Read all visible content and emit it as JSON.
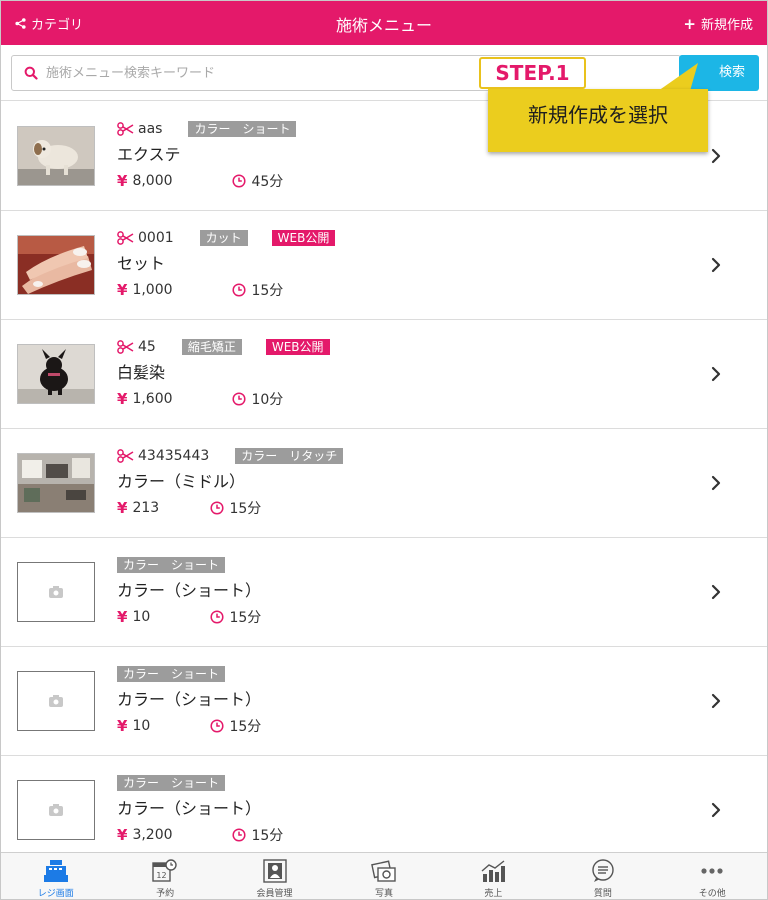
{
  "header": {
    "left_label": "カテゴリ",
    "title": "施術メニュー",
    "right_label": "新規作成",
    "color": "#e4196a"
  },
  "search": {
    "placeholder": "施術メニュー検索キーワード",
    "button_label": "検索",
    "button_color": "#1cb6e6"
  },
  "callout": {
    "step": "STEP.1",
    "text": "新規作成を選択",
    "color": "#ebcd1e"
  },
  "items": [
    {
      "code": "aas",
      "tags": [
        "カラー　ショート"
      ],
      "web": "",
      "name": "エクステ",
      "price": "8,000",
      "duration": "45分",
      "thumb": "dog"
    },
    {
      "code": "0001",
      "tags": [
        "カット"
      ],
      "web": "WEB公開",
      "name": "セット",
      "price": "1,000",
      "duration": "15分",
      "thumb": "nails"
    },
    {
      "code": "45",
      "tags": [
        "縮毛矯正"
      ],
      "web": "WEB公開",
      "name": "白髪染",
      "price": "1,600",
      "duration": "10分",
      "thumb": "blackdog"
    },
    {
      "code": "43435443",
      "tags": [
        "カラー　リタッチ"
      ],
      "web": "",
      "name": "カラー（ミドル）",
      "price": "213",
      "duration": "15分",
      "thumb": "salon"
    },
    {
      "code": "",
      "tags": [
        "カラー　ショート"
      ],
      "web": "",
      "name": "カラー（ショート）",
      "price": "10",
      "duration": "15分",
      "thumb": "empty"
    },
    {
      "code": "",
      "tags": [
        "カラー　ショート"
      ],
      "web": "",
      "name": "カラー（ショート）",
      "price": "10",
      "duration": "15分",
      "thumb": "empty"
    },
    {
      "code": "",
      "tags": [
        "カラー　ショート"
      ],
      "web": "",
      "name": "カラー（ショート）",
      "price": "3,200",
      "duration": "15分",
      "thumb": "empty"
    }
  ],
  "currency_symbol": "¥",
  "tabbar": {
    "tabs": [
      {
        "label": "レジ画面",
        "icon": "register-icon",
        "active": true
      },
      {
        "label": "予約",
        "icon": "calendar-icon",
        "active": false,
        "badge": "12"
      },
      {
        "label": "会員管理",
        "icon": "member-icon",
        "active": false
      },
      {
        "label": "写真",
        "icon": "camera-icon",
        "active": false
      },
      {
        "label": "売上",
        "icon": "sales-chart-icon",
        "active": false
      },
      {
        "label": "質問",
        "icon": "chat-icon",
        "active": false
      },
      {
        "label": "その他",
        "icon": "more-icon",
        "active": false
      }
    ]
  }
}
